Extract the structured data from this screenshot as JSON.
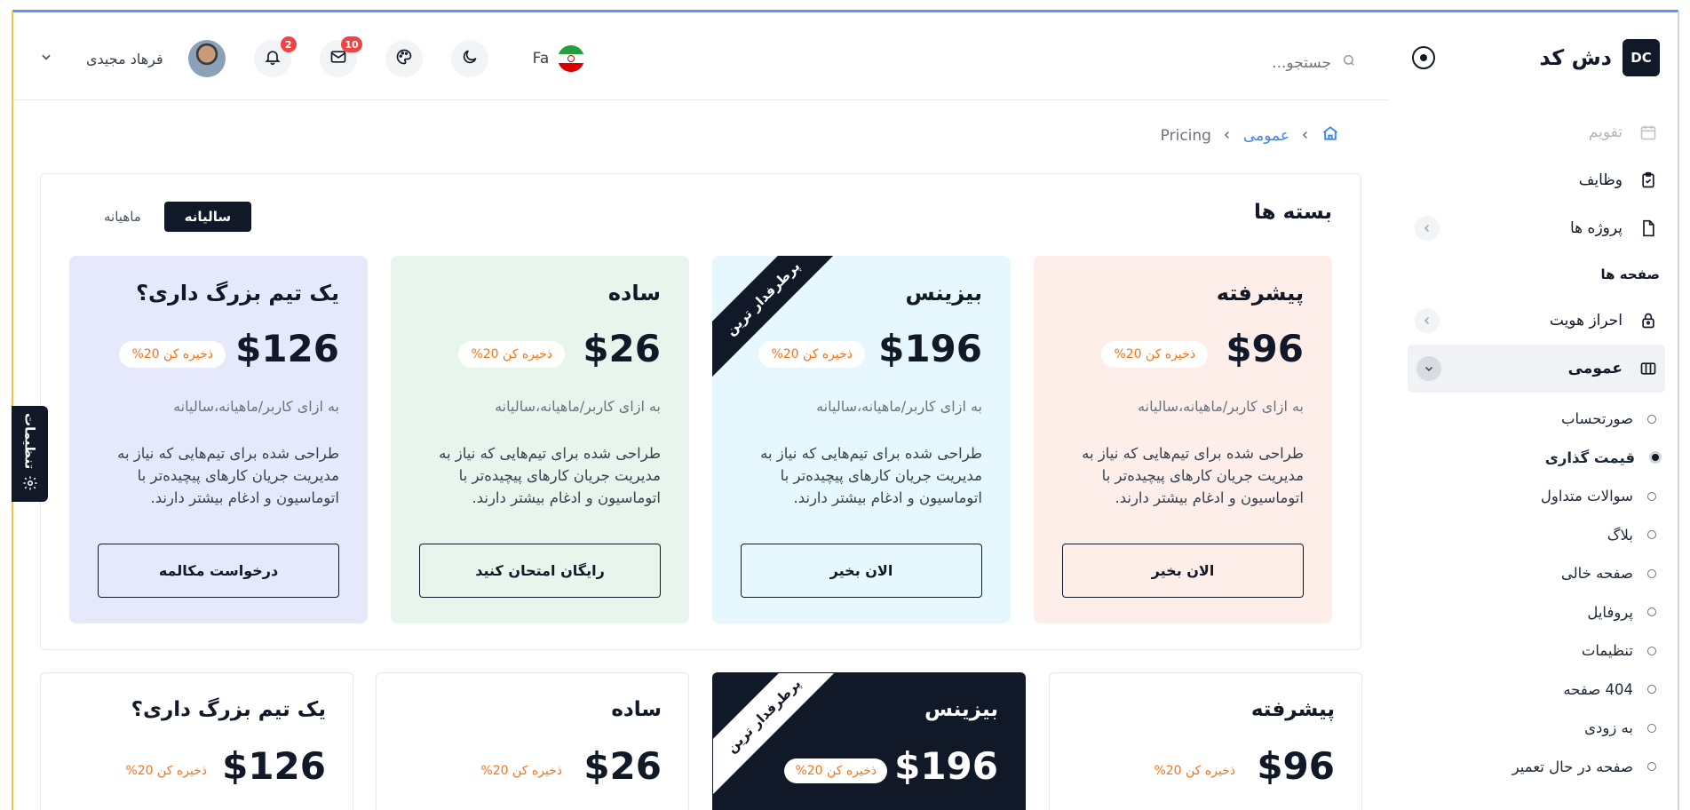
{
  "brand": {
    "name": "دش کد",
    "logo_text": "DC"
  },
  "header": {
    "search_placeholder": "جستجو...",
    "language": "Fa",
    "notifications_count": "2",
    "messages_count": "10",
    "user_name": "فرهاد مجیدی"
  },
  "sidebar": {
    "items": [
      {
        "label": "تقویم",
        "icon": "calendar-icon",
        "muted": true
      },
      {
        "label": "وظایف",
        "icon": "clipboard-check-icon"
      },
      {
        "label": "پروژه ها",
        "icon": "file-icon",
        "has_arrow": true
      }
    ],
    "section_pages": "صفحه ها",
    "auth": {
      "label": "احراز هویت",
      "icon": "lock-icon"
    },
    "general": {
      "label": "عمومی",
      "icon": "columns-icon"
    },
    "sub_items": [
      "صورتحساب",
      "قیمت گذاری",
      "سوالات متداول",
      "بلاگ",
      "صفحه خالی",
      "پروفایل",
      "تنظیمات",
      "404 صفحه",
      "به زودی",
      "صفحه در حال تعمیر"
    ],
    "current_sub": "قیمت گذاری"
  },
  "breadcrumb": {
    "parent": "عمومی",
    "current": "Pricing"
  },
  "pricing": {
    "title": "بسته ها",
    "toggle": {
      "yearly": "سالیانه",
      "monthly": "ماهیانه"
    },
    "per_user": "به ازای کاربر/ماهیانه،سالیانه",
    "description": "طراحی شده برای تیم‌هایی که نیاز به مدیریت جریان کارهای پیچیده‌تر با اتوماسیون و ادغام بیشتر دارند.",
    "save_label": "ذخیره کن 20%",
    "ribbon": "پرطرفدار ترین",
    "plans": [
      {
        "name": "پیشرفته",
        "price": "$96",
        "cta": "الان بخیر",
        "bg": "#fdeee9"
      },
      {
        "name": "بیزینس",
        "price": "$196",
        "cta": "الان بخیر",
        "bg": "#e6f7fd"
      },
      {
        "name": "ساده",
        "price": "$26",
        "cta": "رایگان امتحان کنید",
        "bg": "#e7f5ec"
      },
      {
        "name": "یک تیم بزرگ داری؟",
        "price": "$126",
        "cta": "درخواست مکالمه",
        "bg": "#e6e9fb"
      }
    ]
  },
  "settings_tab": {
    "label": "تنظیمات"
  },
  "colors": {
    "accent": "#3b82f6",
    "dark": "#111827",
    "save_orange": "#f97316"
  }
}
